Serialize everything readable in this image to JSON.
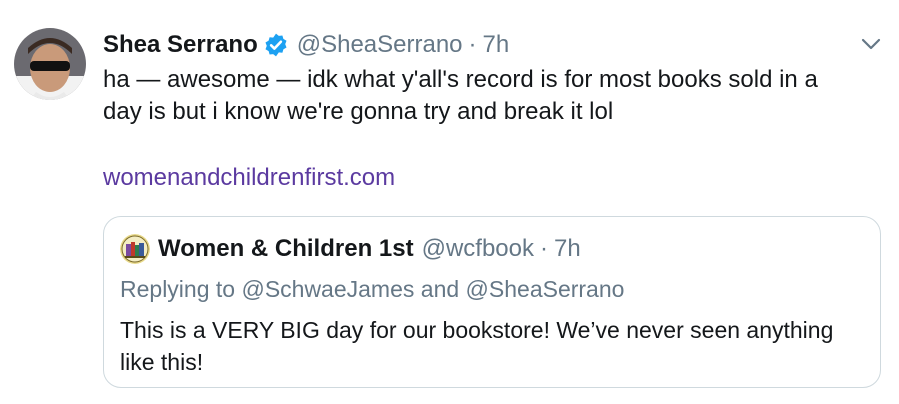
{
  "tweet": {
    "author": {
      "name": "Shea Serrano",
      "handle": "@SheaSerrano",
      "verified": true,
      "avatar_icon": "user-avatar"
    },
    "separator": "·",
    "time": "7h",
    "text": "ha — awesome — idk what y'all's record is for most books sold in a day is but i know we're gonna try and break it lol",
    "link": "womenandchildrenfirst.com",
    "menu_icon": "chevron-down-icon",
    "colors": {
      "link": "#5b3aa0",
      "verified": "#1da1f2",
      "secondary": "#657786"
    }
  },
  "quoted": {
    "author": {
      "name": "Women & Children 1st",
      "handle": "@wcfbook",
      "avatar_icon": "bookstore-logo"
    },
    "separator": "·",
    "time": "7h",
    "replying_prefix": "Replying to",
    "replying_to_1": "@SchwaeJames",
    "replying_and": "and",
    "replying_to_2": "@SheaSerrano",
    "text": "This is a VERY BIG day for our bookstore! We’ve never seen anything like this!"
  }
}
